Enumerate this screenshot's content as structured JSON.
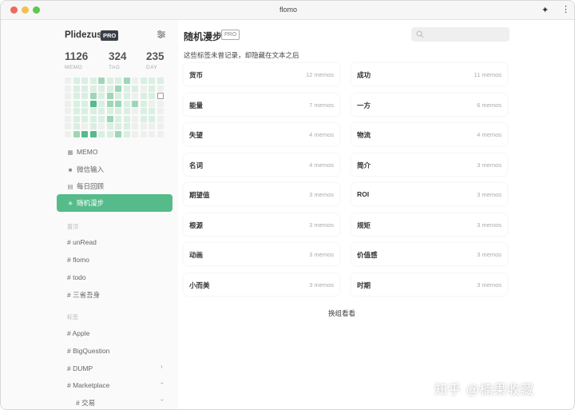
{
  "window": {
    "title": "flomo"
  },
  "sidebar": {
    "username": "Plidezus",
    "pro": "PRO",
    "stats": [
      {
        "value": "1126",
        "label": "MEMO"
      },
      {
        "value": "324",
        "label": "TAG"
      },
      {
        "value": "235",
        "label": "DAY"
      }
    ],
    "heatmap_levels": [
      [
        0,
        1,
        1,
        1,
        2,
        1,
        1,
        2,
        0,
        1,
        1,
        1
      ],
      [
        0,
        1,
        1,
        1,
        1,
        1,
        2,
        1,
        1,
        0,
        1,
        0
      ],
      [
        0,
        1,
        1,
        2,
        1,
        2,
        1,
        1,
        0,
        1,
        1,
        0
      ],
      [
        0,
        1,
        1,
        3,
        1,
        2,
        2,
        1,
        2,
        1,
        0,
        0
      ],
      [
        0,
        1,
        1,
        1,
        1,
        1,
        1,
        1,
        0,
        1,
        1,
        0
      ],
      [
        0,
        1,
        1,
        1,
        1,
        2,
        1,
        1,
        0,
        1,
        1,
        0
      ],
      [
        0,
        1,
        0,
        1,
        0,
        1,
        1,
        1,
        0,
        0,
        0,
        0
      ],
      [
        0,
        2,
        3,
        3,
        1,
        1,
        2,
        1,
        0,
        0,
        0,
        0
      ]
    ],
    "nav": [
      {
        "label": "MEMO",
        "icon": "grid-icon",
        "active": false
      },
      {
        "label": "微信输入",
        "icon": "chat-icon",
        "active": false
      },
      {
        "label": "每日回顾",
        "icon": "calendar-icon",
        "active": false
      },
      {
        "label": "随机漫步",
        "icon": "sparkle-icon",
        "active": true
      }
    ],
    "pinned_label": "置顶",
    "pinned_tags": [
      "# unRead",
      "# flomo",
      "# todo",
      "# 三省吾身"
    ],
    "all_tags_label": "标签",
    "all_tags": [
      {
        "label": "# Apple",
        "chevron": ""
      },
      {
        "label": "# BigQuestion",
        "chevron": ""
      },
      {
        "label": "# DUMP",
        "chevron": "›"
      },
      {
        "label": "# Marketplace",
        "chevron": "‹"
      },
      {
        "label": "# 交易",
        "chevron": "‹"
      }
    ]
  },
  "main": {
    "title": "随机漫步",
    "pro": "PRO",
    "search_placeholder": "",
    "subtitle": "这些标签未曾记录，却隐藏在文本之后",
    "cards": [
      {
        "name": "货币",
        "count": "12 memos"
      },
      {
        "name": "成功",
        "count": "11 memos"
      },
      {
        "name": "能量",
        "count": "7 memos"
      },
      {
        "name": "一方",
        "count": "6 memos"
      },
      {
        "name": "失望",
        "count": "4 memos"
      },
      {
        "name": "物流",
        "count": "4 memos"
      },
      {
        "name": "名词",
        "count": "4 memos"
      },
      {
        "name": "简介",
        "count": "3 memos"
      },
      {
        "name": "期望值",
        "count": "3 memos"
      },
      {
        "name": "ROI",
        "count": "3 memos"
      },
      {
        "name": "根源",
        "count": "3 memos"
      },
      {
        "name": "规矩",
        "count": "3 memos"
      },
      {
        "name": "动画",
        "count": "3 memos"
      },
      {
        "name": "价值感",
        "count": "3 memos"
      },
      {
        "name": "小而美",
        "count": "3 memos"
      },
      {
        "name": "时期",
        "count": "3 memos"
      }
    ],
    "shuffle_label": "换组看看"
  },
  "watermark": "知乎 @楠果收藏",
  "colors": {
    "accent": "#55bb8a",
    "heat1": "#d9efe2",
    "heat2": "#9fd6b6",
    "heat3": "#55bb8a"
  }
}
